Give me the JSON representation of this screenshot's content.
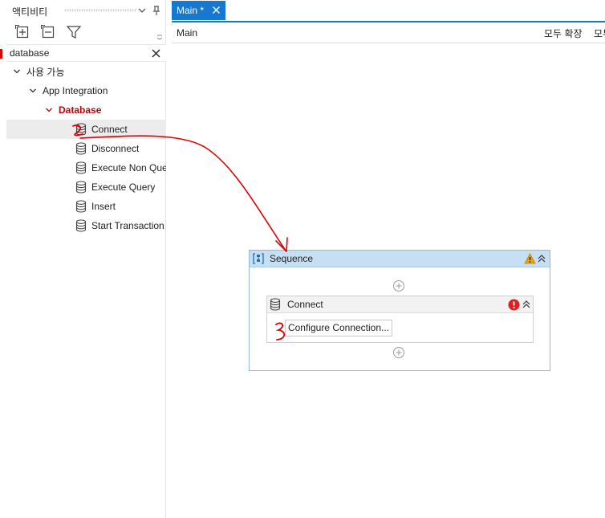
{
  "activities_panel": {
    "title": "액티비티",
    "search": {
      "value": "database",
      "placeholder": ""
    },
    "tree": {
      "root_label": "사용 가능",
      "group_label": "App Integration",
      "category_label": "Database",
      "items": [
        {
          "label": "Connect"
        },
        {
          "label": "Disconnect"
        },
        {
          "label": "Execute Non Query"
        },
        {
          "label": "Execute Query"
        },
        {
          "label": "Insert"
        },
        {
          "label": "Start Transaction"
        }
      ]
    }
  },
  "document_tab": {
    "label": "Main *"
  },
  "designer": {
    "breadcrumb": "Main",
    "expand_all": "모두 확장",
    "collapse_all": "모두 축소",
    "sequence": {
      "title": "Sequence",
      "activity": {
        "title": "Connect",
        "configure_label": "Configure Connection..."
      }
    }
  },
  "colors": {
    "accent_tab": "#1679cf",
    "category_text": "#c00000",
    "annotation_red": "#e00000",
    "sequence_header": "#c6dff3",
    "warning": "#f0a30a",
    "error": "#e02020"
  },
  "icons": {
    "expand_all": "plus-square-icon",
    "collapse_all": "minus-square-icon",
    "filter": "filter-icon",
    "database": "database-icon",
    "sequence": "sequence-icon",
    "warning": "warning-icon",
    "error": "error-icon",
    "add": "add-circle-icon"
  }
}
